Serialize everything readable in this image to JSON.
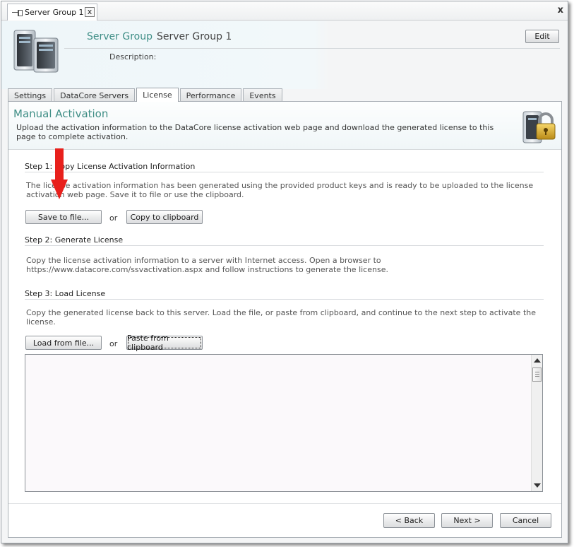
{
  "doc_tab": {
    "title": "Server Group 1",
    "close_symbol": "x"
  },
  "window": {
    "close_symbol": "x"
  },
  "header": {
    "prefix": "Server Group",
    "name": "Server Group 1",
    "description_label": "Description:",
    "edit_label": "Edit"
  },
  "tabs": [
    {
      "label": "Settings",
      "active": false
    },
    {
      "label": "DataCore Servers",
      "active": false
    },
    {
      "label": "License",
      "active": true
    },
    {
      "label": "Performance",
      "active": false
    },
    {
      "label": "Events",
      "active": false
    }
  ],
  "page": {
    "title": "Manual Activation",
    "description": "Upload the activation information to the DataCore license activation web page and download the generated license to this page to complete activation."
  },
  "step1": {
    "title": "Step 1: Copy License Activation Information",
    "text": "The license activation information has been generated using the provided product keys and is ready to be uploaded to the license activation web page. Save it to file or use the clipboard.",
    "save_label": "Save to file...",
    "or": "or",
    "copy_label": "Copy to clipboard"
  },
  "step2": {
    "title": "Step 2: Generate License",
    "text": "Copy the license activation information to a server with Internet access. Open a browser to https://www.datacore.com/ssvactivation.aspx and follow instructions to generate the license."
  },
  "step3": {
    "title": "Step 3: Load License",
    "text": "Copy the generated license back to this server. Load the file, or paste from clipboard, and continue to the next step to activate the license.",
    "load_label": "Load from file...",
    "or": "or",
    "paste_label": "Paste from clipboard",
    "license_text": ""
  },
  "footer": {
    "back_label": "< Back",
    "next_label": "Next >",
    "cancel_label": "Cancel"
  },
  "colors": {
    "accent": "#3f8e86",
    "annotation_arrow": "#e8201c"
  }
}
